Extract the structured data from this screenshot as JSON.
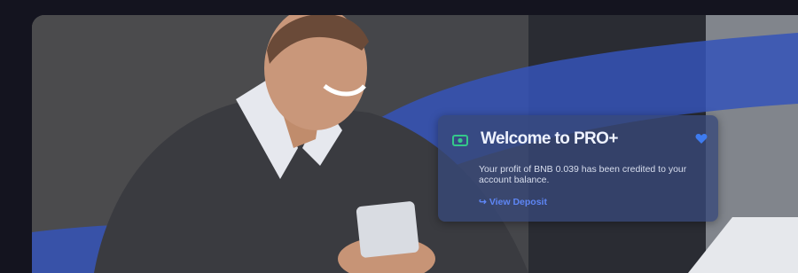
{
  "notification": {
    "title": "Welcome to PRO+",
    "message": "Your profit of BNB 0.039 has been credited to your account balance.",
    "link_label": "View Deposit",
    "link_arrow": "↪",
    "icons": [
      "camera-icon",
      "heart-icon"
    ]
  },
  "colors": {
    "page_background": "#14141f",
    "notification_background": "#374878",
    "accent_blue": "#5e86f5",
    "wave_blue": "#3553b8"
  }
}
